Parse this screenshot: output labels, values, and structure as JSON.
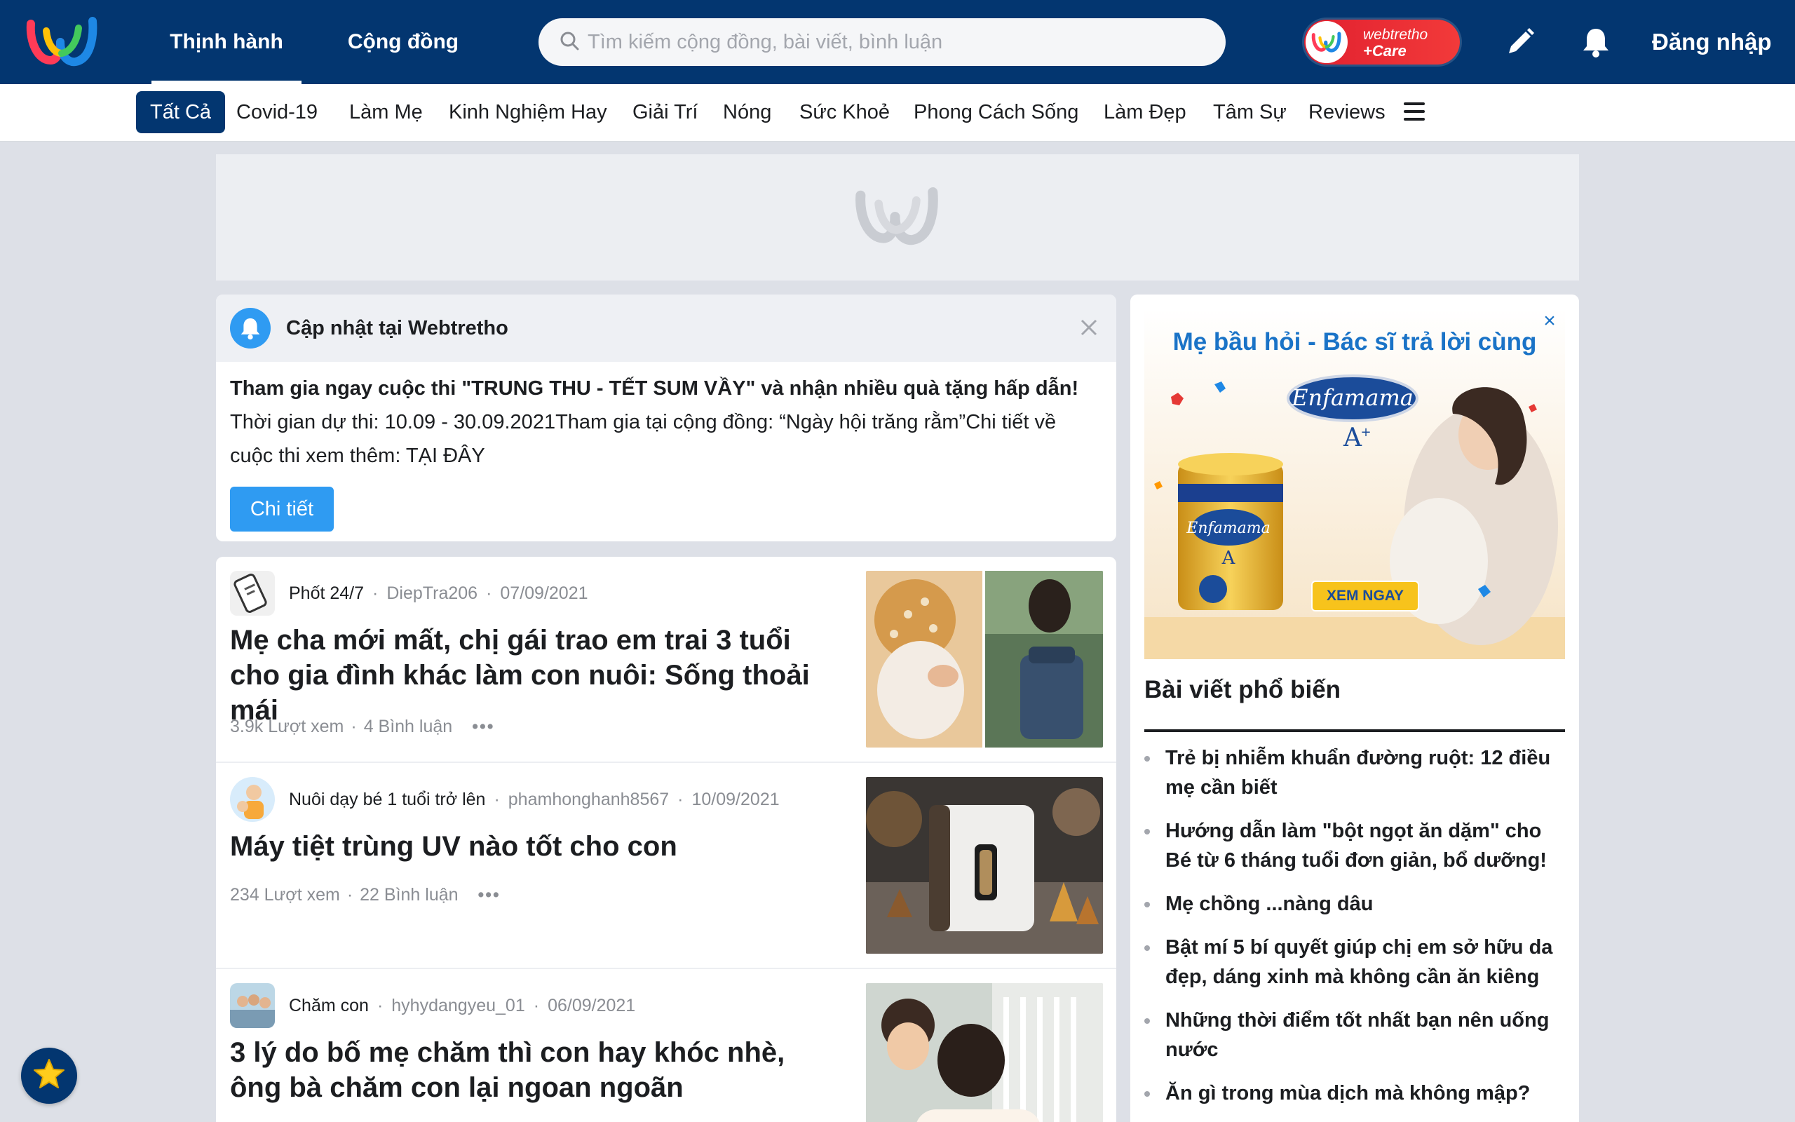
{
  "header": {
    "tabs": [
      {
        "label": "Thịnh hành",
        "active": true
      },
      {
        "label": "Cộng đồng",
        "active": false
      }
    ],
    "search_placeholder": "Tìm kiếm cộng đồng, bài viết, bình luận",
    "care_badge": {
      "line1": "webtretho",
      "line2": "+Care"
    },
    "login_label": "Đăng nhập",
    "icons": [
      "webtretho-logo-icon",
      "pencil-icon",
      "bell-icon"
    ],
    "brand_color": "#033670"
  },
  "categories": {
    "items": [
      "Tất Cả",
      "Covid-19",
      "Làm Mẹ",
      "Kinh Nghiệm Hay",
      "Giải Trí",
      "Nóng",
      "Sức Khoẻ",
      "Phong Cách Sống",
      "Làm Đẹp",
      "Tâm Sự",
      "Reviews"
    ],
    "active": "Tất Cả"
  },
  "notice": {
    "title": "Cập nhật tại Webtretho",
    "headline": "Tham gia ngay cuộc thi \"TRUNG THU - TẾT SUM VẦY\" và nhận nhiều quà tặng hấp dẫn!",
    "body": "Thời gian dự thi: 10.09 - 30.09.2021Tham gia tại cộng đồng: “Ngày hội trăng rằm”Chi tiết về cuộc thi xem thêm: TẠI ĐÂY",
    "button_label": "Chi tiết",
    "accent_color": "#2f9bf2"
  },
  "posts": [
    {
      "community": "Phốt 24/7",
      "author": "DiepTra206",
      "date": "07/09/2021",
      "title": "Mẹ cha mới mất, chị gái trao em trai 3 tuổi cho gia đình khác làm con nuôi: Sống thoải mái",
      "views": "3.9k Lượt xem",
      "comments": "4 Bình luận"
    },
    {
      "community": "Nuôi dạy bé 1 tuổi trở lên",
      "author": "phamhonghanh8567",
      "date": "10/09/2021",
      "title": "Máy tiệt trùng UV nào tốt cho con",
      "views": "234 Lượt xem",
      "comments": "22 Bình luận"
    },
    {
      "community": "Chăm con",
      "author": "hyhydangyeu_01",
      "date": "06/09/2021",
      "title": "3 lý do bố mẹ chăm thì con hay khóc nhè, ông bà chăm con lại ngoan ngoãn",
      "views": "",
      "comments": ""
    }
  ],
  "sidebar": {
    "promo": {
      "title": "Mẹ bầu hỏi - Bác sĩ trả lời cùng",
      "brand": "Enfamama",
      "brand_suffix": "A+",
      "cta": "XEM NGAY"
    },
    "popular_title": "Bài viết phổ biến",
    "popular": [
      "Trẻ bị nhiễm khuẩn đường ruột: 12 điều mẹ cần biết",
      "Hướng dẫn làm \"bột ngọt ăn dặm\" cho Bé từ 6 tháng tuổi đơn giản, bổ dưỡng!",
      "Mẹ chồng ...nàng dâu",
      "Bật mí 5 bí quyết giúp chị em sở hữu da đẹp, dáng xinh mà không cần ăn kiêng",
      "Những thời điểm tốt nhất bạn nên uống nước",
      "Ăn gì trong mùa dịch mà không mập?"
    ]
  }
}
